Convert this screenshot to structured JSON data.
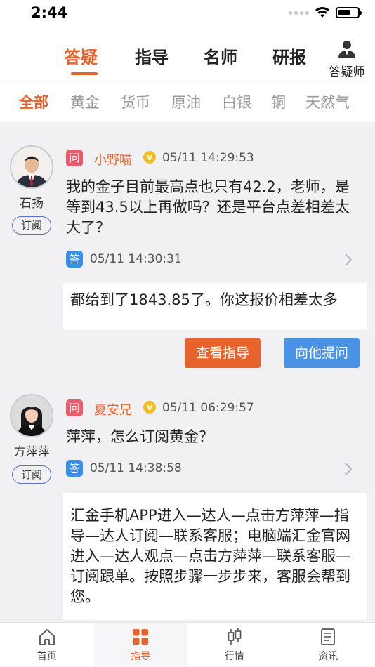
{
  "status_bar": {
    "time": "2:44"
  },
  "top_tabs": {
    "items": [
      {
        "label": "答疑",
        "active": true
      },
      {
        "label": "指导",
        "active": false
      },
      {
        "label": "名师",
        "active": false
      },
      {
        "label": "研报",
        "active": false
      }
    ],
    "answerer_label": "答疑师",
    "accent_color": "#e8622c"
  },
  "categories": [
    {
      "label": "全部",
      "active": true
    },
    {
      "label": "黄金"
    },
    {
      "label": "货币"
    },
    {
      "label": "原油"
    },
    {
      "label": "白银"
    },
    {
      "label": "铜"
    },
    {
      "label": "天然气"
    }
  ],
  "feed": [
    {
      "user_name": "石扬",
      "subscribe_label": "订阅",
      "q_badge": "问",
      "asker": "小野喵",
      "q_time": "05/11 14:29:53",
      "question": "我的金子目前最高点也只有42.2，老师，是等到43.5以上再做吗？还是平台点差相差太大了？",
      "a_badge": "答",
      "a_time": "05/11 14:30:31",
      "answer": "都给到了1843.85了。你这报价相差太多",
      "guide_btn": "查看指导",
      "ask_btn": "向他提问"
    },
    {
      "user_name": "方萍萍",
      "subscribe_label": "订阅",
      "q_badge": "问",
      "asker": "夏安兄",
      "q_time": "05/11 06:29:57",
      "question": "萍萍，怎么订阅黄金？",
      "a_badge": "答",
      "a_time": "05/11 14:38:58",
      "answer": "汇金手机APP进入—达人—点击方萍萍—指导—达人订阅—联系客服；电脑端汇金官网进入—达人观点—点击方萍萍—联系客服—订阅跟单。按照步骤一步步来，客服会帮到您。"
    }
  ],
  "bottom_nav": [
    {
      "label": "首页",
      "icon": "home-icon"
    },
    {
      "label": "指导",
      "icon": "grid-icon",
      "active": true
    },
    {
      "label": "行情",
      "icon": "candlestick-icon"
    },
    {
      "label": "资讯",
      "icon": "news-icon"
    }
  ]
}
